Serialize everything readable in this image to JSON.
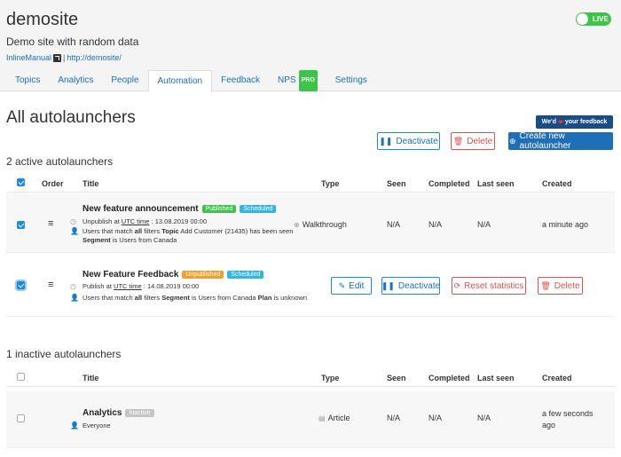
{
  "header": {
    "site_title": "demosite",
    "site_description": "Demo site with random data",
    "brand_link": "InlineManual",
    "separator": "|",
    "site_url": "http://demosite/",
    "live_label": "LIVE",
    "tabs": [
      {
        "label": "Topics"
      },
      {
        "label": "Analytics"
      },
      {
        "label": "People"
      },
      {
        "label": "Automation",
        "active": true
      },
      {
        "label": "Feedback"
      },
      {
        "label": "NPS",
        "badge": "PRO"
      },
      {
        "label": "Settings"
      }
    ]
  },
  "main": {
    "title": "All autolaunchers",
    "feedback_button": {
      "pre": "We'd",
      "post": "your feedback"
    },
    "toolbar": {
      "deactivate": "Deactivate",
      "delete": "Delete",
      "create": "Create new autolauncher"
    },
    "active_section": {
      "title": "2 active autolaunchers",
      "columns": {
        "order": "Order",
        "title": "Title",
        "type": "Type",
        "seen": "Seen",
        "completed": "Completed",
        "last_seen": "Last seen",
        "created": "Created"
      },
      "rows": [
        {
          "title": "New feature announcement",
          "badges": [
            "Published",
            "Scheduled"
          ],
          "schedule_prefix": "Unpublish at",
          "schedule_link": "UTC time",
          "schedule_value": ": 13.08.2019 00:00",
          "seg_1": "Users that match",
          "seg_2": "all",
          "seg_3": "filters",
          "seg_4": "Topic",
          "seg_5": "Add Customer (21435) has been seen",
          "seg_6": "Segment",
          "seg_7": "is Users from Canada",
          "type": "Walkthrough",
          "seen": "N/A",
          "completed": "N/A",
          "last_seen": "N/A",
          "created": "a minute ago"
        },
        {
          "title": "New Feature Feedback",
          "badges": [
            "Unpublished",
            "Scheduled"
          ],
          "schedule_prefix": "Publish at",
          "schedule_link": "UTC time",
          "schedule_value": ": 14.08.2019 00:00",
          "seg_1": "Users that match",
          "seg_2": "all",
          "seg_3": "filters",
          "seg_4": "Segment",
          "seg_5": "is Users from Canada",
          "seg_6": "Plan",
          "seg_7": "is unknown",
          "actions": {
            "edit": "Edit",
            "deactivate": "Deactivate",
            "reset": "Reset statistics",
            "delete": "Delete"
          }
        }
      ]
    },
    "inactive_section": {
      "title": "1 inactive autolaunchers",
      "columns": {
        "title": "Title",
        "type": "Type",
        "seen": "Seen",
        "completed": "Completed",
        "last_seen": "Last seen",
        "created": "Created"
      },
      "rows": [
        {
          "title": "Analytics",
          "badge": "Inactive",
          "audience": "Everyone",
          "type": "Article",
          "seen": "N/A",
          "completed": "N/A",
          "last_seen": "N/A",
          "created_1": "a few seconds",
          "created_2": "ago"
        }
      ]
    }
  },
  "colors": {
    "accent": "#1e6fb8",
    "live": "#3ec34b",
    "danger": "#d9534f",
    "feedback_bg": "#1a4d85"
  }
}
